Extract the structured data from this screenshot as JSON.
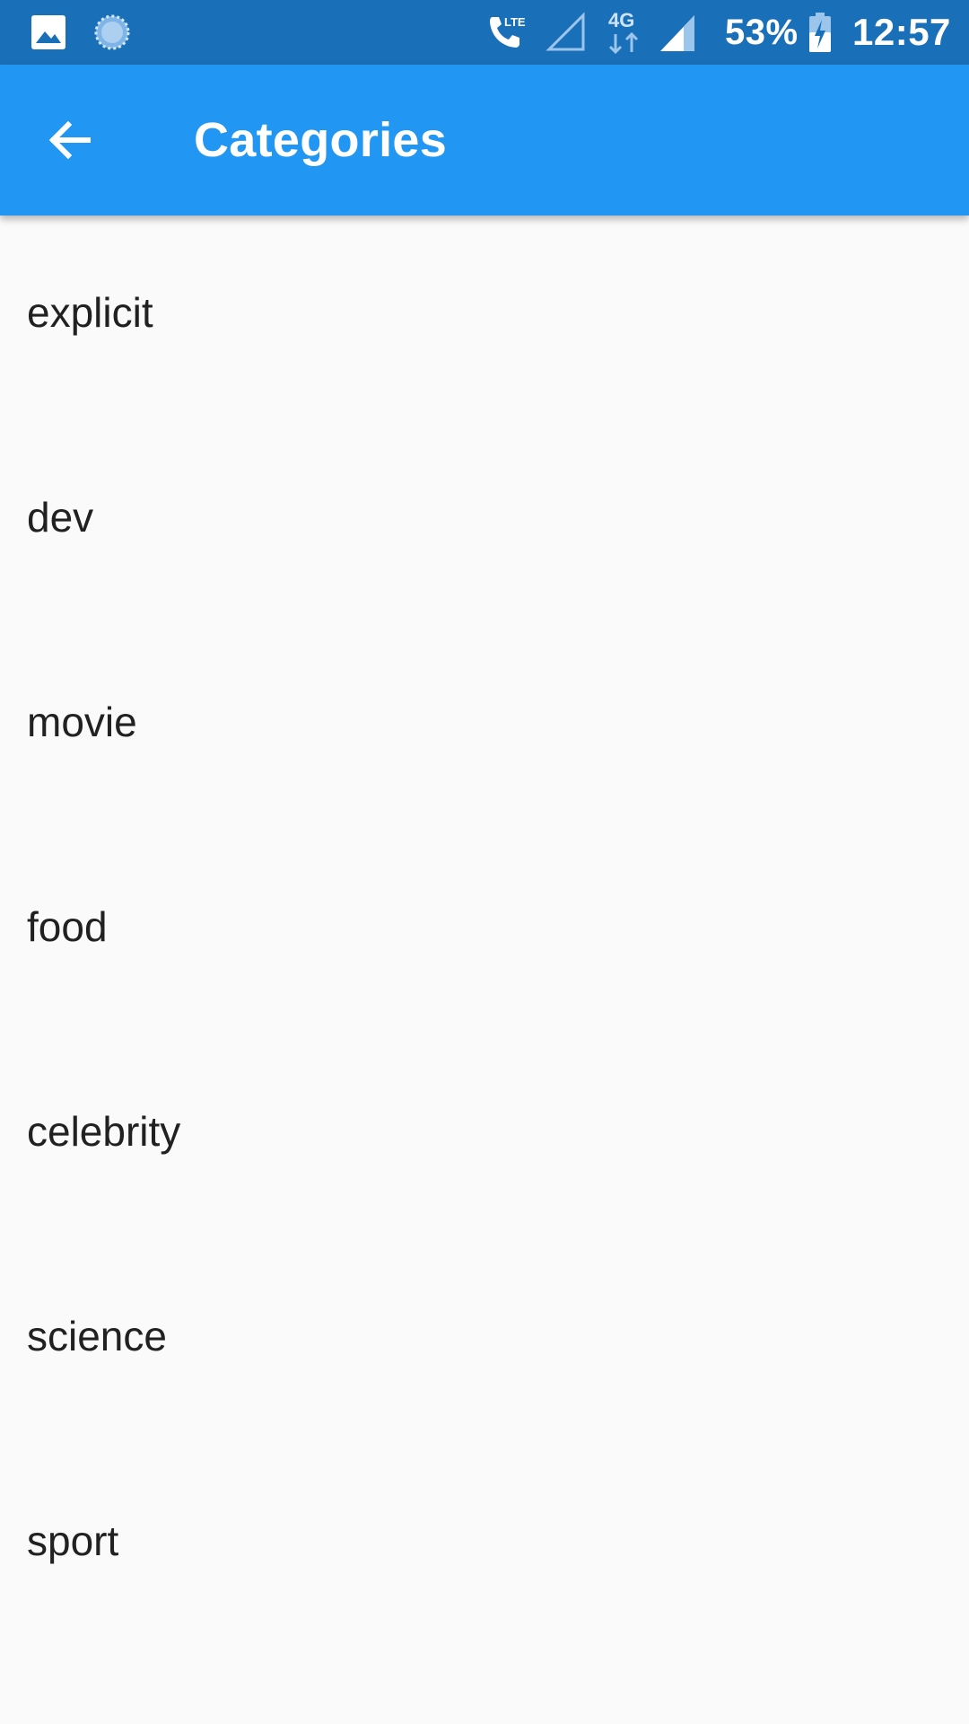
{
  "status_bar": {
    "battery_percent": "53%",
    "time": "12:57",
    "network_label": "4G",
    "call_badge": "LTE",
    "background_color": "#1a70b8",
    "icons": [
      "gallery-icon",
      "sync-icon",
      "volte-call-icon",
      "signal-empty-icon",
      "data-arrows-icon",
      "signal-full-icon",
      "battery-charging-icon"
    ]
  },
  "app_bar": {
    "title": "Categories",
    "back_icon": "arrow-left-icon",
    "background_color": "#2196f3"
  },
  "categories": [
    {
      "label": "explicit"
    },
    {
      "label": "dev"
    },
    {
      "label": "movie"
    },
    {
      "label": "food"
    },
    {
      "label": "celebrity"
    },
    {
      "label": "science"
    },
    {
      "label": "sport"
    }
  ]
}
